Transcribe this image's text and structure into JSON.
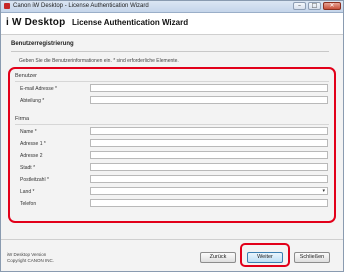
{
  "window": {
    "title": "Canon iW Desktop - License Authentication Wizard",
    "controls": {
      "minimize": "–",
      "maximize": "□",
      "close": "✕"
    }
  },
  "header": {
    "brand": "i W  Desktop",
    "wizard_title": "License Authentication Wizard"
  },
  "section": {
    "title": "Benutzerregistrierung",
    "instructions": "Geben Sie die Benutzerinformationen ein. * sind erforderliche Elemente."
  },
  "groups": {
    "user": {
      "label": "Benutzer",
      "fields": [
        {
          "label": "E-mail Adresse *",
          "value": ""
        },
        {
          "label": "Abteilung *",
          "value": ""
        }
      ]
    },
    "company": {
      "label": "Firma",
      "fields": [
        {
          "label": "Name *",
          "value": ""
        },
        {
          "label": "Adresse 1 *",
          "value": ""
        },
        {
          "label": "Adresse 2",
          "value": ""
        },
        {
          "label": "Stadt *",
          "value": ""
        },
        {
          "label": "Postleitzahl *",
          "value": ""
        },
        {
          "label": "Land *",
          "value": "",
          "arrow": "▾"
        },
        {
          "label": "Telefon",
          "value": ""
        }
      ]
    }
  },
  "footer": {
    "version_line1": "iW Desktop Version",
    "version_line2": "Copyright CANON INC.",
    "buttons": {
      "back": "Zurück",
      "next": "Weiter",
      "close": "Schließen"
    }
  },
  "colors": {
    "highlight": "#e2001a",
    "title_bar": "#c5d5ea",
    "background": "#f3f3f3"
  }
}
